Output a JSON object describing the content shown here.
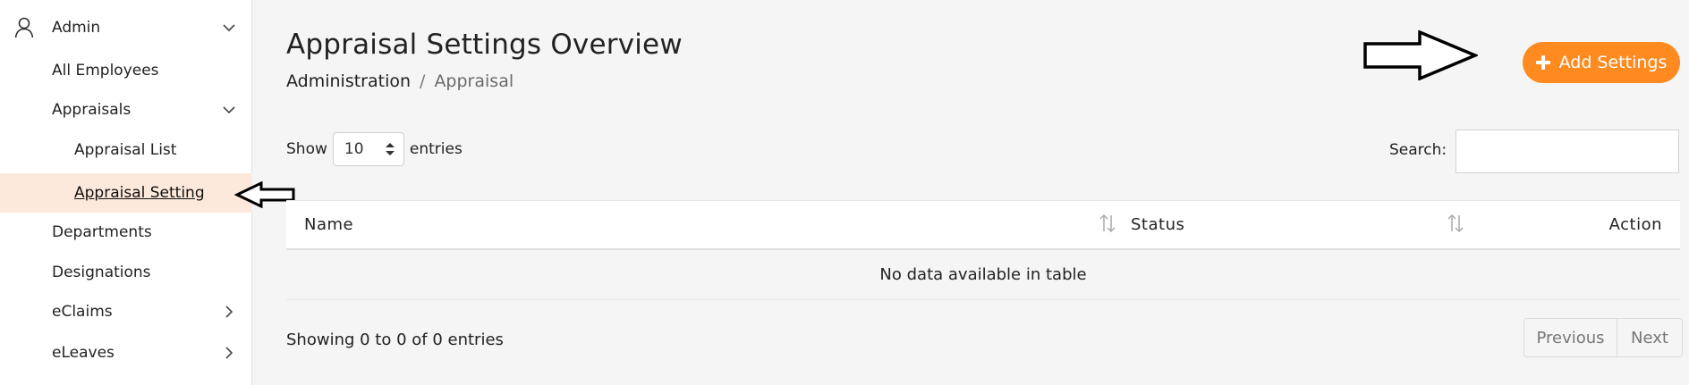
{
  "sidebar": {
    "admin_label": "Admin",
    "items": [
      {
        "label": "All Employees"
      },
      {
        "label": "Appraisals"
      },
      {
        "label": "Appraisal List"
      },
      {
        "label": "Appraisal Setting"
      },
      {
        "label": "Departments"
      },
      {
        "label": "Designations"
      },
      {
        "label": "eClaims"
      },
      {
        "label": "eLeaves"
      }
    ]
  },
  "header": {
    "title": "Appraisal Settings Overview",
    "breadcrumb": {
      "first": "Administration",
      "separator": "/",
      "current": "Appraisal"
    },
    "add_button_label": "Add Settings"
  },
  "table_controls": {
    "show_label": "Show",
    "entries_value": "10",
    "entries_label": "entries",
    "search_label": "Search:",
    "search_value": ""
  },
  "table": {
    "columns": [
      "Name",
      "Status",
      "Action"
    ],
    "empty_message": "No data available in table"
  },
  "footer": {
    "showing_text": "Showing 0 to 0 of 0 entries",
    "previous_label": "Previous",
    "next_label": "Next"
  },
  "colors": {
    "accent": "#ff8a1f",
    "active_item_bg": "#fde9dc"
  }
}
